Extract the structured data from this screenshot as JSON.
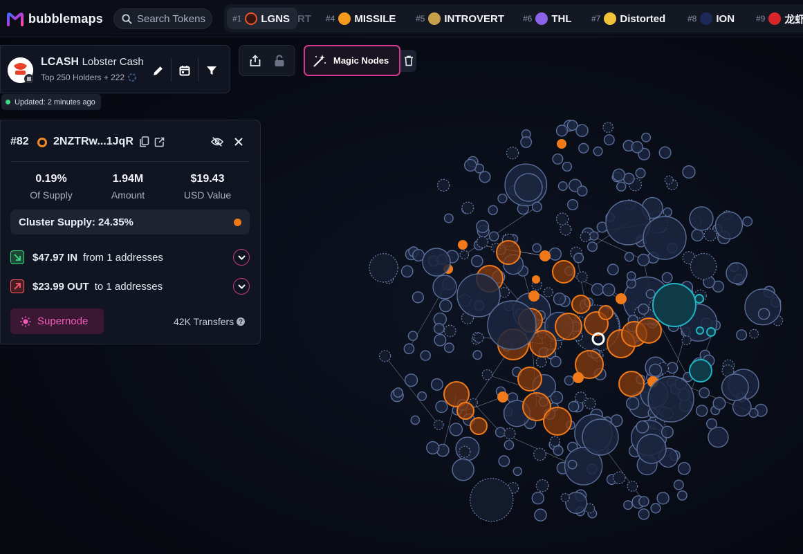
{
  "brand": {
    "name": "bubblemaps"
  },
  "search": {
    "placeholder": "Search Tokens"
  },
  "ticker": [
    {
      "rank": "#1",
      "name": "LGNS",
      "color": "#e8552a"
    },
    {
      "rank": "",
      "name": "RT",
      "color": ""
    },
    {
      "rank": "#4",
      "name": "MISSILE",
      "color": "#f59a1a"
    },
    {
      "rank": "#5",
      "name": "INTROVERT",
      "color": "#c9a04a"
    },
    {
      "rank": "#6",
      "name": "THL",
      "color": "#8a63e8"
    },
    {
      "rank": "#7",
      "name": "Distorted",
      "color": "#f0c23a"
    },
    {
      "rank": "#8",
      "name": "ION",
      "color": "#1d2a57"
    },
    {
      "rank": "#9",
      "name": "龙虾",
      "color": "#d8262a"
    }
  ],
  "token": {
    "symbol": "LCASH",
    "name": "Lobster Cash",
    "subtitle": "Top 250 Holders + 222",
    "updated": "Updated: 2 minutes ago"
  },
  "magic": {
    "label": "Magic Nodes"
  },
  "wallet": {
    "rank": "#82",
    "address": "2NZTRw...1JqR",
    "stats": [
      {
        "value": "0.19%",
        "label": "Of Supply"
      },
      {
        "value": "1.94M",
        "label": "Amount"
      },
      {
        "value": "$19.43",
        "label": "USD Value"
      }
    ],
    "cluster_supply": "Cluster Supply: 24.35%",
    "inflow": {
      "amount": "$47.97 IN",
      "text": "from 1 addresses"
    },
    "outflow": {
      "amount": "$23.99 OUT",
      "text": "to 1 addresses"
    },
    "supernode": "Supernode",
    "transfers": "42K Transfers"
  },
  "colors": {
    "accent_pink": "#d4388f",
    "cluster_orange": "#f07a1a",
    "cluster_teal": "#1fb5c4",
    "node_blue": "#1b2640",
    "node_stroke": "#5a6f9a"
  }
}
